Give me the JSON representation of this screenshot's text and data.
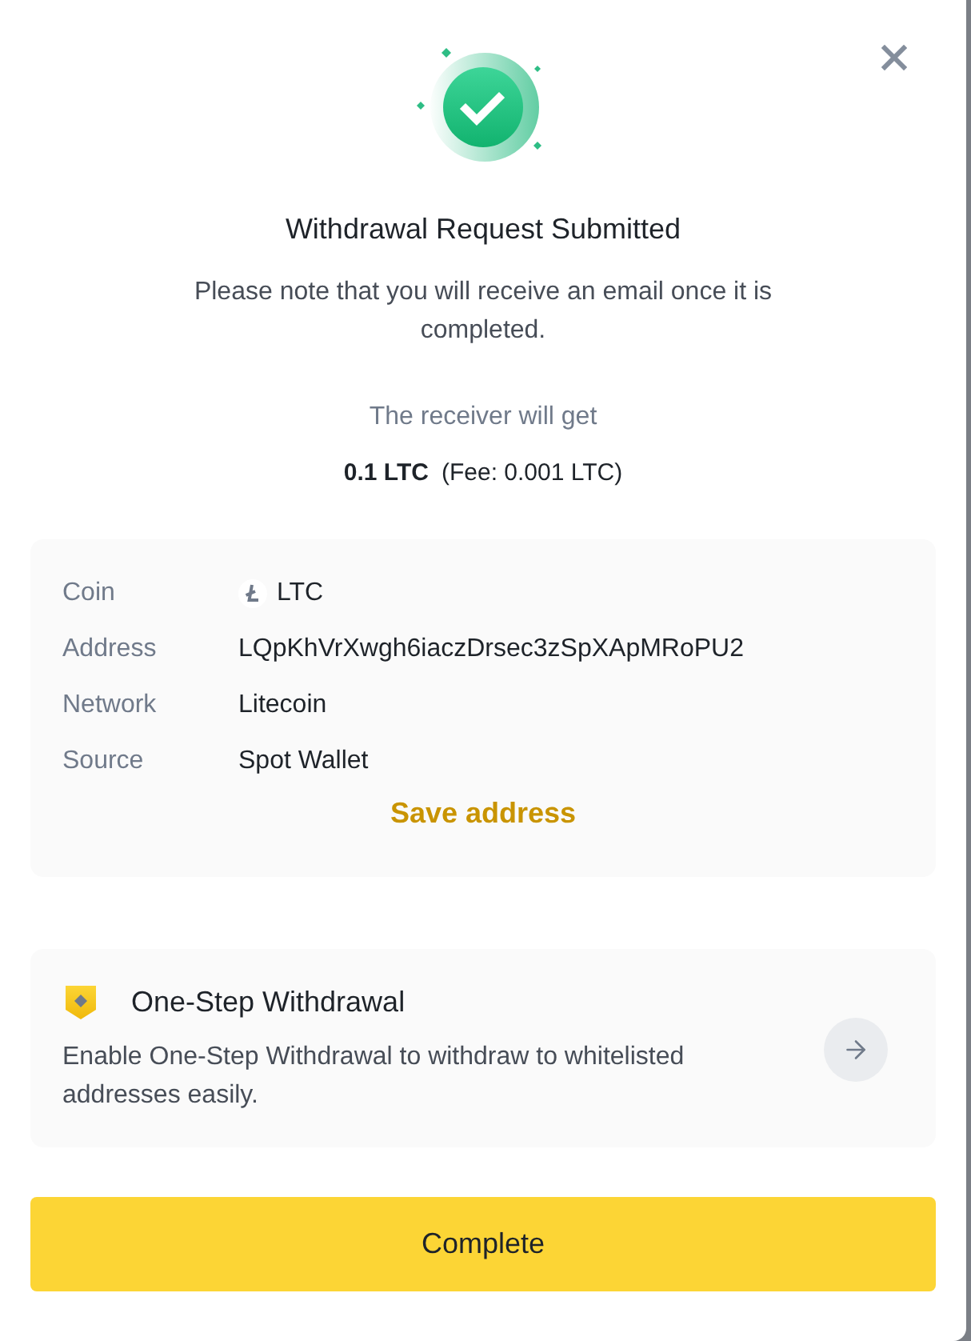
{
  "header": {
    "title": "Withdrawal Request Submitted",
    "message": "Please note that you will receive an email once it is completed."
  },
  "receiver": {
    "label": "The receiver will get",
    "amount": "0.1 LTC",
    "fee": "(Fee: 0.001 LTC)"
  },
  "details": {
    "rows": [
      {
        "kind": "coin",
        "label": "Coin",
        "value": "LTC"
      },
      {
        "kind": "text",
        "label": "Address",
        "value": "LQpKhVrXwgh6iaczDrsec3zSpXApMRoPU2"
      },
      {
        "kind": "text",
        "label": "Network",
        "value": "Litecoin"
      },
      {
        "kind": "text",
        "label": "Source",
        "value": "Spot Wallet"
      }
    ],
    "save_link": "Save address"
  },
  "one_step": {
    "title": "One-Step Withdrawal",
    "description": "Enable One-Step Withdrawal to withdraw to whitelisted addresses easily."
  },
  "complete_button": {
    "label": "Complete"
  }
}
